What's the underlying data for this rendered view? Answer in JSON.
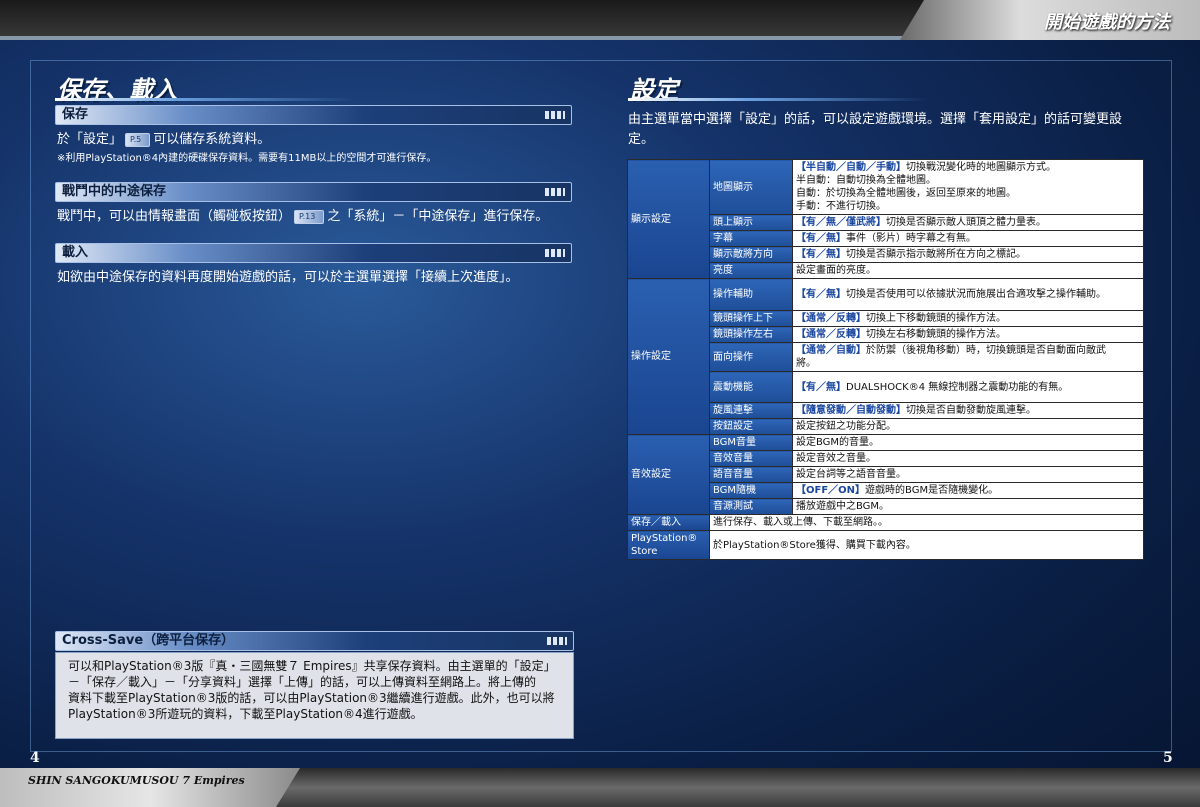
{
  "header": {
    "title": "開始遊戲的方法"
  },
  "footer": {
    "game_title": "SHIN SANGOKUMUSOU 7 Empires",
    "page_left": "4",
    "page_right": "5"
  },
  "left": {
    "section_title": "保存、載入",
    "save": {
      "heading": "保存",
      "line1_a": "於「設定」",
      "line1_ref": "P.5",
      "line1_b": "可以儲存系統資料。",
      "note": "※利用PlayStation®4內建的硬碟保存資料。需要有11MB以上的空間才可進行保存。"
    },
    "midsave": {
      "heading": "戰鬥中的中途保存",
      "line_a": "戰鬥中，可以由情報畫面（觸碰板按鈕）",
      "line_ref": "P.13",
      "line_b": "之「系統」－「中途保存」進行保存。"
    },
    "load": {
      "heading": "載入",
      "line": "如欲由中途保存的資料再度開始遊戲的話，可以於主選單選擇「接續上次進度」。"
    },
    "cross_save": {
      "heading": "Cross-Save（跨平台保存）",
      "lines": [
        "可以和PlayStation®3版『真・三國無雙７ Empires』共享保存資料。由主選單的「設定」",
        "－「保存／載入」－「分享資料」選擇「上傳」的話，可以上傳資料至網路上。將上傳的",
        "資料下載至PlayStation®3版的話，可以由PlayStation®3繼續進行遊戲。此外，也可以將",
        "PlayStation®3所遊玩的資料，下載至PlayStation®4進行遊戲。"
      ]
    }
  },
  "right": {
    "section_title": "設定",
    "intro_lines": [
      "由主選單當中選擇「設定」的話，可以設定遊戲環境。選擇「套用設定」的話可變更設",
      "定。"
    ],
    "table": {
      "display": {
        "category": "顯示設定",
        "map": {
          "item": "地圖顯示",
          "hl": "【半自動／自動／手動】",
          "desc": "切換戰況變化時的地圖顯示方式。",
          "extra": [
            "半自動：自動切換為全體地圖。",
            "自動：於切換為全體地圖後，返回至原來的地圖。",
            "手動：不進行切換。"
          ]
        },
        "head": {
          "item": "頭上顯示",
          "hl": "【有／無／僅武將】",
          "desc": "切換是否顯示敵人頭頂之體力量表。"
        },
        "subtitle": {
          "item": "字幕",
          "hl": "【有／無】",
          "desc": "事件（影片）時字幕之有無。"
        },
        "enemy_dir": {
          "item": "顯示敵將方向",
          "hl": "【有／無】",
          "desc": "切換是否顯示指示敵將所在方向之標記。"
        },
        "brightness": {
          "item": "亮度",
          "desc": "設定畫面的亮度。"
        }
      },
      "control": {
        "category": "操作設定",
        "assist": {
          "item": "操作輔助",
          "hl": "【有／無】",
          "desc": "切換是否使用可以依據狀況而施展出合適攻擊之操作輔助。"
        },
        "cam_ud": {
          "item": "鏡頭操作上下",
          "hl": "【通常／反轉】",
          "desc": "切換上下移動鏡頭的操作方法。"
        },
        "cam_lr": {
          "item": "鏡頭操作左右",
          "hl": "【通常／反轉】",
          "desc": "切換左右移動鏡頭的操作方法。"
        },
        "face": {
          "item": "面向操作",
          "hl": "【通常／自動】",
          "desc": "於防禦（後視角移動）時，切換鏡頭是否自動面向敵武",
          "desc2": "將。"
        },
        "vibration": {
          "item": "震動機能",
          "hl": "【有／無】",
          "desc": "DUALSHOCK®4 無線控制器之震動功能的有無。"
        },
        "musou": {
          "item": "旋風連擊",
          "hl": "【隨意發動／自動發動】",
          "desc": "切換是否自動發動旋風連擊。"
        },
        "button": {
          "item": "按鈕設定",
          "desc": "設定按鈕之功能分配。"
        }
      },
      "sound": {
        "category": "音效設定",
        "bgm": {
          "item": "BGM音量",
          "desc": "設定BGM的音量。"
        },
        "se": {
          "item": "音效音量",
          "desc": "設定音效之音量。"
        },
        "voice": {
          "item": "語音音量",
          "desc": "設定台詞等之語音音量。"
        },
        "random": {
          "item": "BGM隨機",
          "hl": "【OFF／ON】",
          "desc": "遊戲時的BGM是否隨機變化。"
        },
        "test": {
          "item": "音源測試",
          "desc": "播放遊戲中之BGM。"
        }
      },
      "saveload": {
        "category": "保存／載入",
        "desc": "進行保存、載入或上傳、下載至網路。。"
      },
      "store": {
        "category_line1": "PlayStation®",
        "category_line2": "Store",
        "desc": "於PlayStation®Store獲得、購買下載內容。"
      }
    }
  }
}
